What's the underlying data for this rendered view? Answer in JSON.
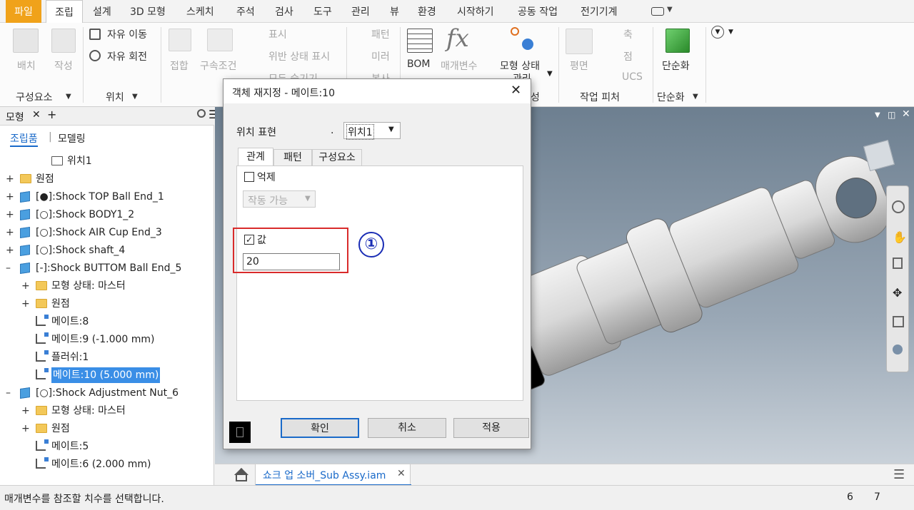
{
  "menubar": {
    "items": [
      "파일",
      "조립",
      "설계",
      "3D 모형",
      "스케치",
      "주석",
      "검사",
      "도구",
      "관리",
      "뷰",
      "환경",
      "시작하기",
      "공동 작업",
      "전기기계"
    ]
  },
  "ribbon": {
    "place_label": "배치",
    "create_label": "작성",
    "component_group": "구성요소",
    "free_move": "자유 이동",
    "free_rotate": "자유 회전",
    "position_group": "위치",
    "joint_label": "접합",
    "constrain_label": "구속조건",
    "show_label": "표시",
    "show_sick_label": "위반 상태 표시",
    "hide_all_label": "모두 숨기기",
    "pattern_label": "패턴",
    "mirror_label": "미러",
    "copy_label": "복사",
    "bom_label": "BOM",
    "params_label": "매개변수",
    "model_state_label": "모형 상태",
    "model_state_sub": "관리",
    "manage_group_suffix": "성",
    "plane_label": "평면",
    "axis_label": "축",
    "point_label": "점",
    "ucs_label": "UCS",
    "work_features_group": "작업 피처",
    "simplify_label": "단순화",
    "simplify_group": "단순화"
  },
  "browser": {
    "tab_label": "모형",
    "assembly_tab": "조립품",
    "modeling_tab": "모델링",
    "items": [
      {
        "label": "위치1",
        "indent": 2,
        "icon": "position-icon",
        "expander": ""
      },
      {
        "label": "원점",
        "indent": 0,
        "icon": "folder-icon",
        "expander": "+"
      },
      {
        "label": "[●]:Shock TOP Ball End_1",
        "indent": 0,
        "icon": "part-icon",
        "expander": "+"
      },
      {
        "label": "[○]:Shock BODY1_2",
        "indent": 0,
        "icon": "part-icon",
        "expander": "+"
      },
      {
        "label": "[○]:Shock AIR Cup End_3",
        "indent": 0,
        "icon": "part-icon",
        "expander": "+"
      },
      {
        "label": "[○]:Shock shaft_4",
        "indent": 0,
        "icon": "part-icon",
        "expander": "+"
      },
      {
        "label": "[-]:Shock BUTTOM Ball End_5",
        "indent": 0,
        "icon": "part-icon",
        "expander": "–"
      },
      {
        "label": "모형 상태: 마스터",
        "indent": 1,
        "icon": "folder-icon",
        "expander": "+"
      },
      {
        "label": "원점",
        "indent": 1,
        "icon": "folder-icon",
        "expander": "+"
      },
      {
        "label": "메이트:8",
        "indent": 1,
        "icon": "mate-icon",
        "expander": ""
      },
      {
        "label": "메이트:9 (-1.000 mm)",
        "indent": 1,
        "icon": "mate-icon",
        "expander": ""
      },
      {
        "label": "플러쉬:1",
        "indent": 1,
        "icon": "flush-icon",
        "expander": ""
      },
      {
        "label": "메이트:10 (5.000 mm)",
        "indent": 1,
        "icon": "mate-icon",
        "expander": "",
        "selected": true
      },
      {
        "label": "[○]:Shock Adjustment Nut_6",
        "indent": 0,
        "icon": "part-icon",
        "expander": "–"
      },
      {
        "label": "모형 상태: 마스터",
        "indent": 1,
        "icon": "folder-icon",
        "expander": "+"
      },
      {
        "label": "원점",
        "indent": 1,
        "icon": "folder-icon",
        "expander": "+"
      },
      {
        "label": "메이트:5",
        "indent": 1,
        "icon": "mate-icon",
        "expander": ""
      },
      {
        "label": "메이트:6 (2.000 mm)",
        "indent": 1,
        "icon": "mate-icon",
        "expander": ""
      }
    ]
  },
  "dialog": {
    "title": "객체 재지정 - 메이트:10",
    "position_label": "위치 표현",
    "position_dot": ".",
    "position_value": "위치1",
    "tabs": [
      "관계",
      "패턴",
      "구성요소"
    ],
    "suppress_label": "억제",
    "suppress_checked": false,
    "drive_value": "작동 가능",
    "value_label": "값",
    "value_checked": true,
    "value_input": "20",
    "annotation": "①",
    "ok": "확인",
    "cancel": "취소",
    "apply": "적용"
  },
  "document_tab": {
    "label": "쇼크 업 소버_Sub Assy.iam"
  },
  "status": {
    "message": "매개변수를 참조할 치수를 선택합니다.",
    "count_a": "6",
    "count_b": "7"
  },
  "colors": {
    "file_tab": "#f0a21a",
    "selection": "#3a8ee6",
    "annotation": "#1a2db5",
    "highlight_box": "#d92b2b"
  }
}
